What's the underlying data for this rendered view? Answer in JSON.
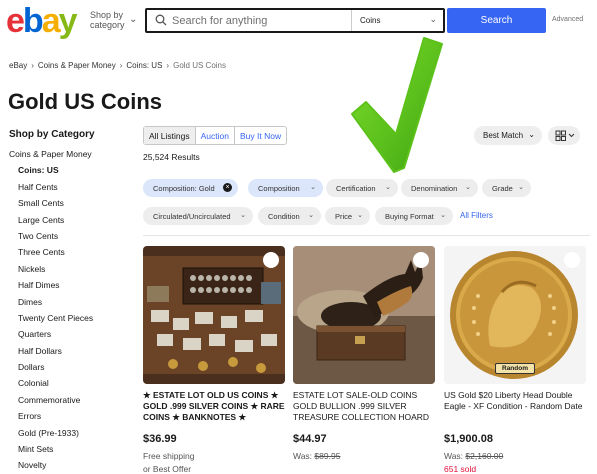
{
  "header": {
    "logo_letters": [
      {
        "ch": "e",
        "color": "#e53238"
      },
      {
        "ch": "b",
        "color": "#0064d2"
      },
      {
        "ch": "a",
        "color": "#f5af02"
      },
      {
        "ch": "y",
        "color": "#86b817"
      }
    ],
    "shop_by_line1": "Shop by",
    "shop_by_line2": "category",
    "search_placeholder": "Search for anything",
    "category_selected": "Coins",
    "search_button": "Search",
    "advanced": "Advanced"
  },
  "breadcrumb": [
    "eBay",
    "Coins & Paper Money",
    "Coins: US",
    "Gold US Coins"
  ],
  "page_title": "Gold US Coins",
  "sidebar": {
    "heading": "Shop by Category",
    "items": [
      {
        "label": "Coins & Paper Money",
        "level": 0
      },
      {
        "label": "Coins: US",
        "level": 1,
        "active": true
      },
      {
        "label": "Half Cents",
        "level": 1
      },
      {
        "label": "Small Cents",
        "level": 1
      },
      {
        "label": "Large Cents",
        "level": 1
      },
      {
        "label": "Two Cents",
        "level": 1
      },
      {
        "label": "Three Cents",
        "level": 1
      },
      {
        "label": "Nickels",
        "level": 1
      },
      {
        "label": "Half Dimes",
        "level": 1
      },
      {
        "label": "Dimes",
        "level": 1
      },
      {
        "label": "Twenty Cent Pieces",
        "level": 1
      },
      {
        "label": "Quarters",
        "level": 1
      },
      {
        "label": "Half Dollars",
        "level": 1
      },
      {
        "label": "Dollars",
        "level": 1
      },
      {
        "label": "Colonial",
        "level": 1
      },
      {
        "label": "Commemorative",
        "level": 1
      },
      {
        "label": "Errors",
        "level": 1
      },
      {
        "label": "Gold (Pre-1933)",
        "level": 1
      },
      {
        "label": "Mint Sets",
        "level": 1
      },
      {
        "label": "Novelty",
        "level": 1
      }
    ]
  },
  "listing_tabs": [
    {
      "label": "All Listings",
      "active": true
    },
    {
      "label": "Auction",
      "active": false
    },
    {
      "label": "Buy It Now",
      "active": false
    }
  ],
  "results_count": "25,524 Results",
  "sort_label": "Best Match",
  "filters_row1": [
    {
      "label": "Composition: Gold",
      "selected": true,
      "removable": true
    },
    {
      "label": "Composition",
      "selected": true
    },
    {
      "label": "Certification"
    },
    {
      "label": "Denomination"
    },
    {
      "label": "Grade"
    }
  ],
  "filters_row2": [
    {
      "label": "Circulated/Uncirculated"
    },
    {
      "label": "Condition"
    },
    {
      "label": "Price"
    },
    {
      "label": "Buying Format"
    }
  ],
  "all_filters": "All Filters",
  "products": [
    {
      "title": "★ ESTATE LOT OLD US COINS ★ GOLD .999 SILVER COINS ★ RARE COINS ★ BANKNOTES ★",
      "price": "$36.99",
      "shipping": "Free shipping",
      "offer": "or Best Offer"
    },
    {
      "title": "ESTATE LOT SALE-OLD COINS GOLD BULLION .999 SILVER TREASURE COLLECTION HOARD",
      "price": "$44.97",
      "was_prefix": "Was: ",
      "was": "$89.95"
    },
    {
      "title": "US Gold $20 Liberty Head Double Eagle - XF Condition - Random Date",
      "price": "$1,900.08",
      "was_prefix": "Was: ",
      "was": "$2,160.00",
      "sold": "651 sold",
      "coin_label": "Random"
    }
  ],
  "colors": {
    "accent_blue": "#3665f3",
    "annotation_arrow": "#5cc21a",
    "sold_red": "#e0103a"
  }
}
